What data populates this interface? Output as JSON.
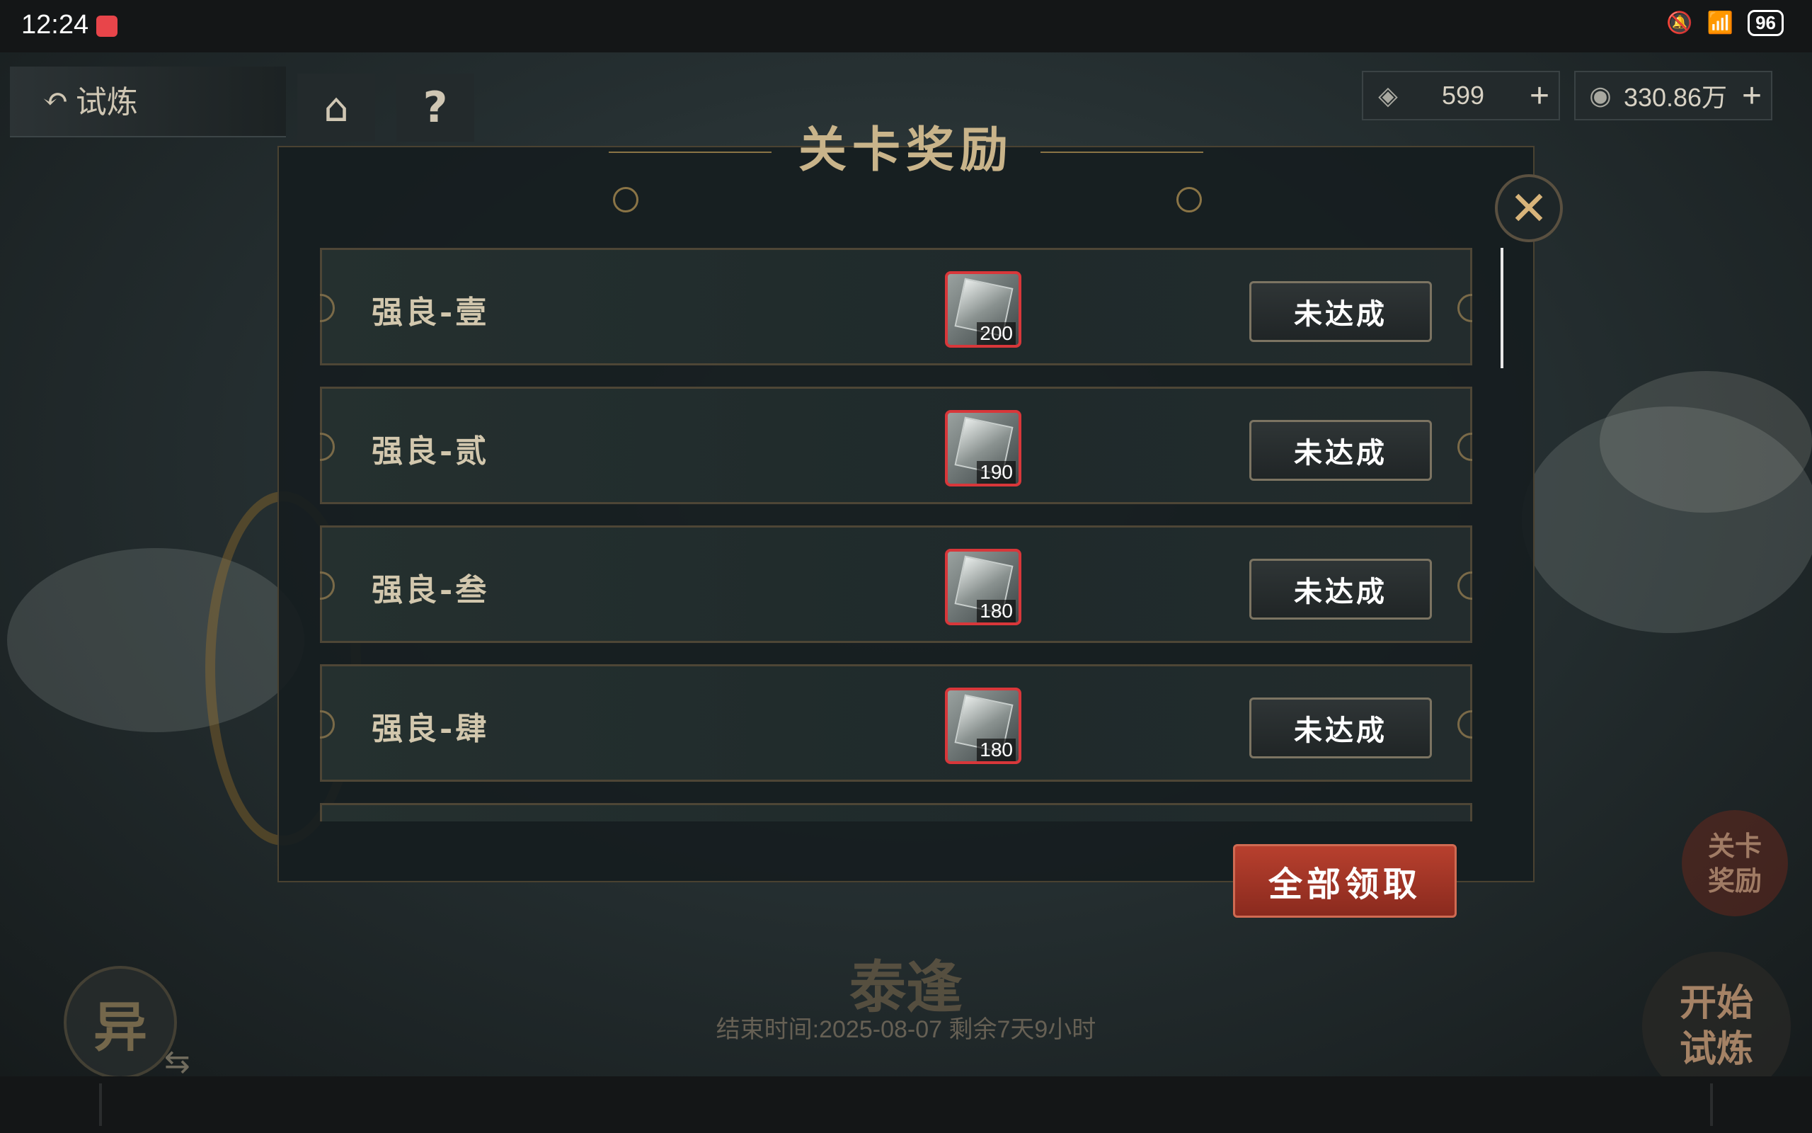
{
  "status_bar": {
    "time": "12:24",
    "battery": "96"
  },
  "header": {
    "back_label": "试炼",
    "help_label": "?",
    "currencies": [
      {
        "icon": "diamond-token-icon",
        "value": "599",
        "plus": "+"
      },
      {
        "icon": "coin-icon",
        "value": "330.86万",
        "plus": "+"
      }
    ]
  },
  "panel": {
    "title": "关卡奖励",
    "close_label": "✕",
    "rows": [
      {
        "label": "强良-壹",
        "item_count": "200",
        "status": "未达成"
      },
      {
        "label": "强良-贰",
        "item_count": "190",
        "status": "未达成"
      },
      {
        "label": "强良-叁",
        "item_count": "180",
        "status": "未达成"
      },
      {
        "label": "强良-肆",
        "item_count": "180",
        "status": "未达成"
      }
    ],
    "claim_all_label": "全部领取"
  },
  "background": {
    "stage_name": "泰逢",
    "end_time_text": "结束时间:2025-08-07  剩余7天9小时",
    "left_circle_label": "异",
    "reward_button_label": "关卡奖励",
    "start_button_label": "开始试炼"
  },
  "colors": {
    "accent": "#c9b48a",
    "claim_button": "#b8402e",
    "item_border": "#d8373a"
  }
}
